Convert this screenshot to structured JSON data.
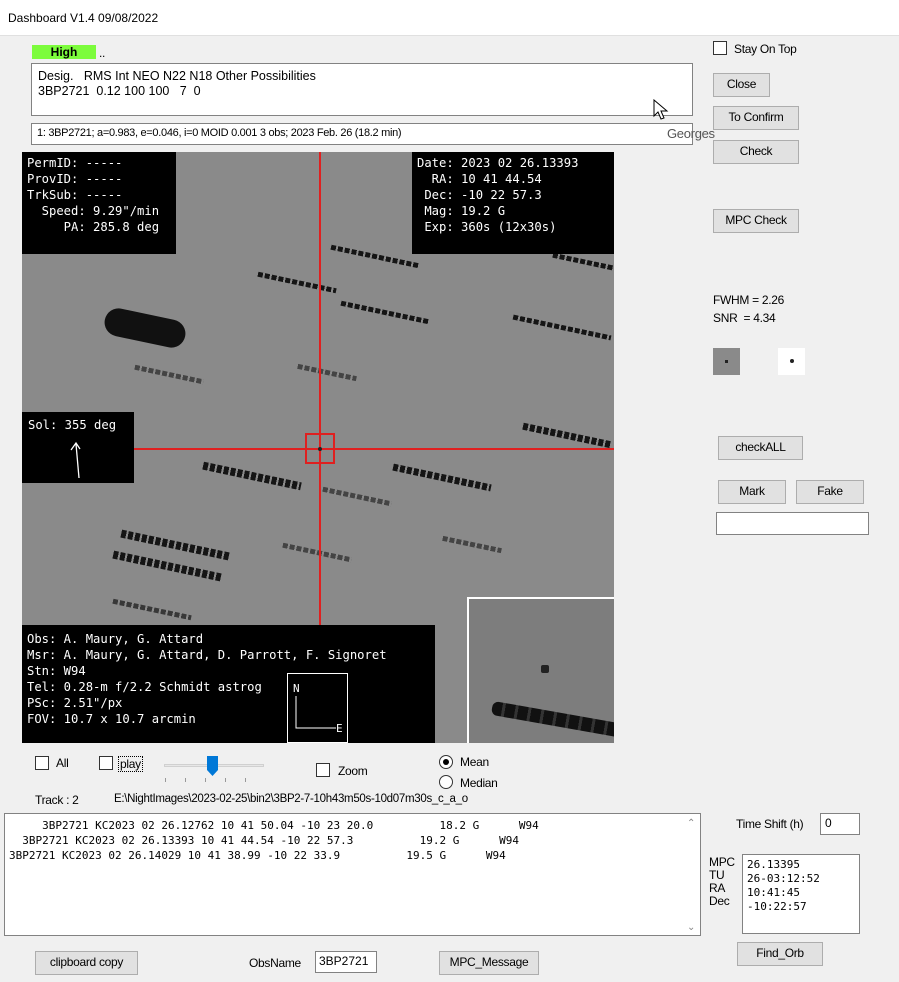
{
  "window": {
    "title": "Dashboard V1.4 09/08/2022"
  },
  "priority": {
    "badge": "High",
    "dots": ".."
  },
  "desig": {
    "line1": "Desig.   RMS Int NEO N22 N18 Other Possibilities",
    "line2": "3BP2721  0.12 100 100   7  0"
  },
  "orbit_summary": "1: 3BP2721; a=0.983, e=0.046, i=0   MOID 0.001    3 obs; 2023 Feb. 26 (18.2 min)",
  "right_panel": {
    "stay_on_top": "Stay On Top",
    "close": "Close",
    "to_confirm": "To Confirm",
    "georges": "Georges",
    "check": "Check",
    "mpc_check": "MPC Check",
    "fwhm": "FWHM = 2.26",
    "snr": "SNR  = 4.34",
    "check_all": "checkALL",
    "mark": "Mark",
    "fake": "Fake",
    "mark_input": ""
  },
  "overlays": {
    "ids": "PermID: -----\nProvID: -----\nTrkSub: -----\n  Speed: 9.29\"/min\n     PA: 285.8 deg",
    "coords": "Date: 2023 02 26.13393\n  RA: 10 41 44.54\n Dec: -10 22 57.3\n Mag: 19.2 G\n Exp: 360s (12x30s)",
    "sol": "Sol: 355 deg",
    "observers": "Obs: A. Maury, G. Attard\nMsr: A. Maury, G. Attard, D. Parrott, F. Signoret\nStn: W94\nTel: 0.28-m f/2.2 Schmidt astrog\nPSc: 2.51\"/px\nFOV: 10.7 x 10.7 arcmin",
    "compass_n": "N",
    "compass_e": "E"
  },
  "controls": {
    "all": "All",
    "play": "play",
    "zoom": "Zoom",
    "mean": "Mean",
    "median": "Median",
    "slider_value": 0.5
  },
  "track": {
    "label": "Track : 2",
    "path": "E:\\NightImages\\2023-02-25\\bin2\\3BP2-7-10h43m50s-10d07m30s_c_a_o"
  },
  "observations": [
    "     3BP2721 KC2023 02 26.12762 10 41 50.04 -10 23 20.0          18.2 G      W94",
    "  3BP2721 KC2023 02 26.13393 10 41 44.54 -10 22 57.3          19.2 G      W94",
    "3BP2721 KC2023 02 26.14029 10 41 38.99 -10 22 33.9          19.5 G      W94"
  ],
  "time_shift": {
    "label": "Time Shift (h)",
    "value": "0"
  },
  "mpc_box": {
    "labels": [
      "MPC",
      "TU",
      "RA",
      "Dec"
    ],
    "values": [
      "26.13395",
      "26-03:12:52",
      "10:41:45",
      "-10:22:57"
    ]
  },
  "bottom": {
    "clipboard": "clipboard copy",
    "obsname_label": "ObsName",
    "obsname_value": "3BP2721",
    "mpc_message": "MPC_Message",
    "find_orb": "Find_Orb"
  }
}
